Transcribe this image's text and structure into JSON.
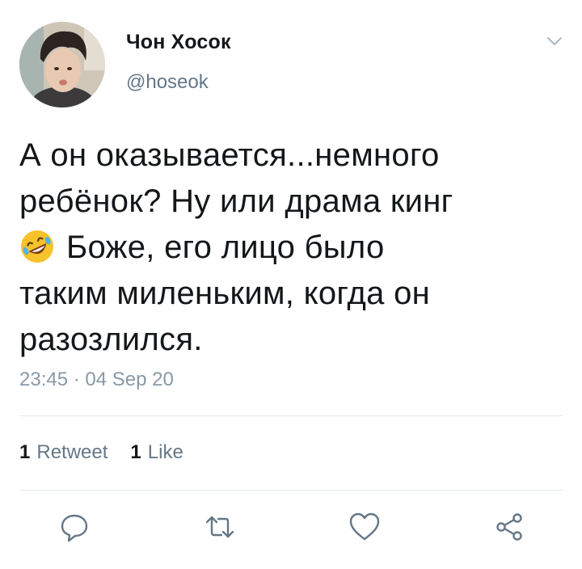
{
  "tweet": {
    "author": {
      "display_name": "Чон Хосок",
      "handle": "@hoseok"
    },
    "text_lines": [
      "А он оказывается...немного",
      "ребёнок? Ну или драма кинг",
      "Боже, его лицо было",
      "таким миленьким, когда он",
      "разозлился."
    ],
    "emoji": "rolling-on-floor-laughing-emoji",
    "timestamp": "23:45 · 04 Sep 20",
    "stats": {
      "retweets_count": "1",
      "retweets_label": "Retweet",
      "likes_count": "1",
      "likes_label": "Like"
    },
    "actions": [
      "reply-icon",
      "retweet-icon",
      "like-icon",
      "share-icon"
    ]
  },
  "colors": {
    "text": "#14171a",
    "secondary": "#657786",
    "divider": "#e1e8ed",
    "icon": "#657786"
  }
}
